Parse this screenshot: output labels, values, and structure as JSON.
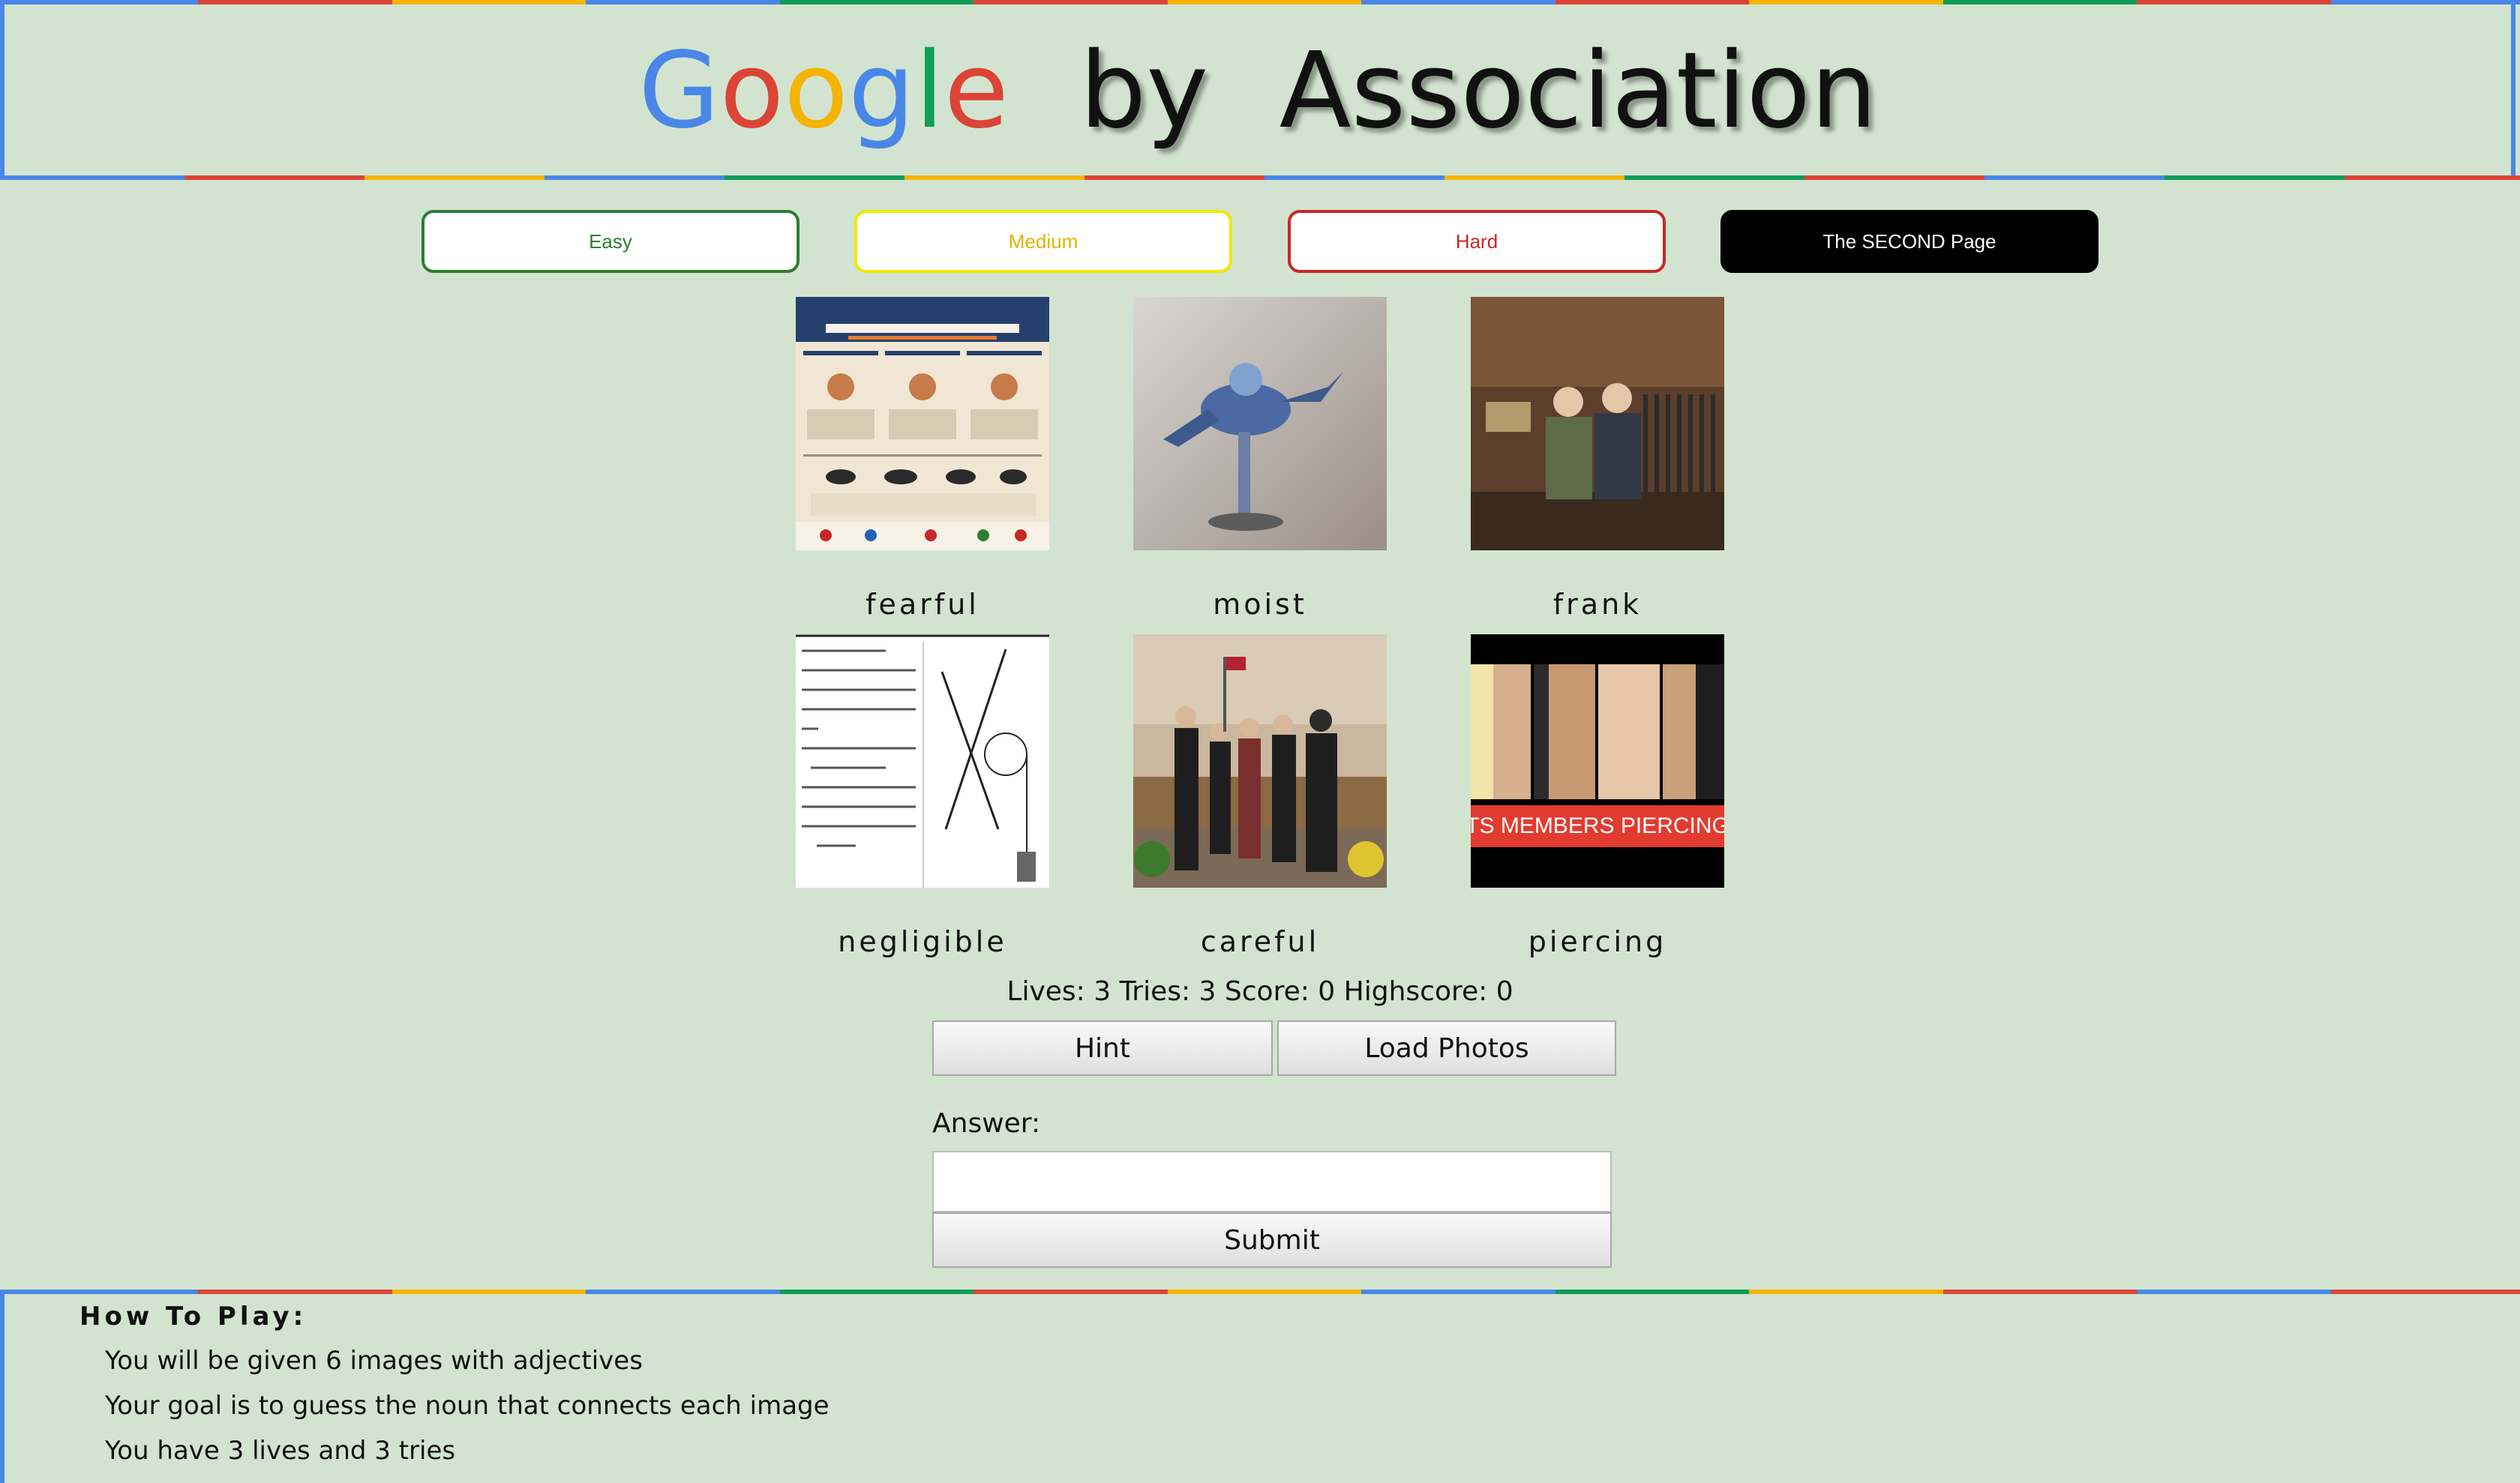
{
  "header": {
    "title_letters": [
      "G",
      "o",
      "o",
      "g",
      "l",
      "e"
    ],
    "title_by": "by",
    "title_association": "Association"
  },
  "modes": {
    "easy": "Easy",
    "medium": "Medium",
    "hard": "Hard",
    "second_page": "The SECOND Page"
  },
  "tiles": [
    {
      "caption": "fearful",
      "image": "fear free fourth poster"
    },
    {
      "caption": "moist",
      "image": "painted miniature figure"
    },
    {
      "caption": "frank",
      "image": "two men in gun shop"
    },
    {
      "caption": "negligible",
      "image": "engineering statics problem"
    },
    {
      "caption": "careful",
      "image": "people at ceremony"
    },
    {
      "caption": "piercing",
      "image": "ear piercings collage",
      "overlay_text": "BTS MEMBERS PIERCINGS"
    }
  ],
  "stats": {
    "text": "Lives: 3 Tries: 3 Score: 0 Highscore: 0"
  },
  "controls": {
    "hint": "Hint",
    "load_photos": "Load Photos",
    "answer_label": "Answer:",
    "answer_value": "",
    "submit": "Submit"
  },
  "howto": {
    "title": "How To Play:",
    "lines": [
      "You will be given 6 images with adjectives",
      "Your goal is to guess the noun that connects each image",
      "You have 3 lives and 3 tries"
    ]
  },
  "colors": {
    "blue": "#4a86e8",
    "red": "#db4437",
    "yellow": "#f4b400",
    "green": "#0f9d58",
    "background": "#d2e4cf"
  }
}
